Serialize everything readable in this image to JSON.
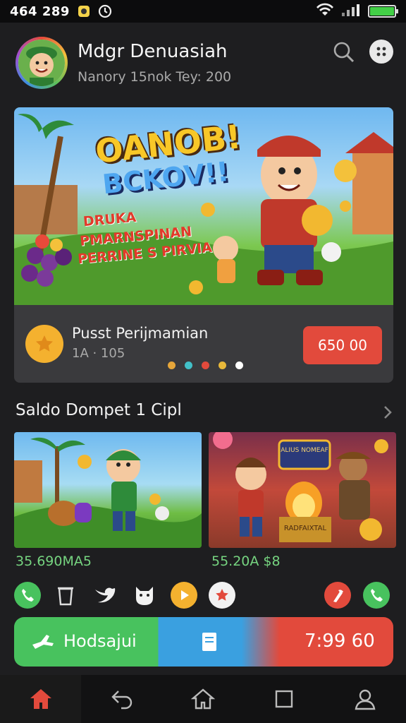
{
  "status_bar": {
    "time": "464 289",
    "icons": [
      "app-badge-icon",
      "clock-icon",
      "wifi-icon",
      "signal-icon",
      "battery-icon"
    ],
    "battery_level": 1.0
  },
  "header": {
    "title": "Mdgr Denuasiah",
    "subtitle": "Nanory 15nok Tey: 200"
  },
  "banner": {
    "headline_1": "OANOB!",
    "headline_2": "BCKOV!!",
    "line_1": "DRUKA",
    "line_2": "PMARNSPINAN",
    "line_3": "PERRINE S PIRVIA"
  },
  "promo": {
    "title": "Pusst Perijmamian",
    "subtitle": "1A · 105",
    "button_label": "650 00",
    "carousel_dots": [
      "#e6a63a",
      "#42c0c8",
      "#e24a3c",
      "#e8b83a",
      "#ffffff"
    ],
    "active_dot": 4
  },
  "section": {
    "title": "Saldo Dompet 1 Cipl",
    "thumbs": [
      {
        "label": "35.690MA5"
      },
      {
        "label": "55.20A $8",
        "caption": "RADFAIXTAL",
        "sign": "ALIUS NOMEAF"
      }
    ]
  },
  "quick_icons": [
    "phone-icon",
    "trash-icon",
    "bird-icon",
    "cat-icon",
    "play-icon",
    "star-icon",
    "flag-icon",
    "call-icon"
  ],
  "action_bar": {
    "label": "Hodsajui",
    "amount": "7:99 60"
  },
  "navbar": {
    "items": [
      "home-icon",
      "back-icon",
      "home-outline-icon",
      "square-icon",
      "profile-icon"
    ]
  },
  "colors": {
    "accent_red": "#e24a3c",
    "accent_green": "#48c25e",
    "accent_blue": "#3aa0e0",
    "gold": "#f4b12f"
  }
}
